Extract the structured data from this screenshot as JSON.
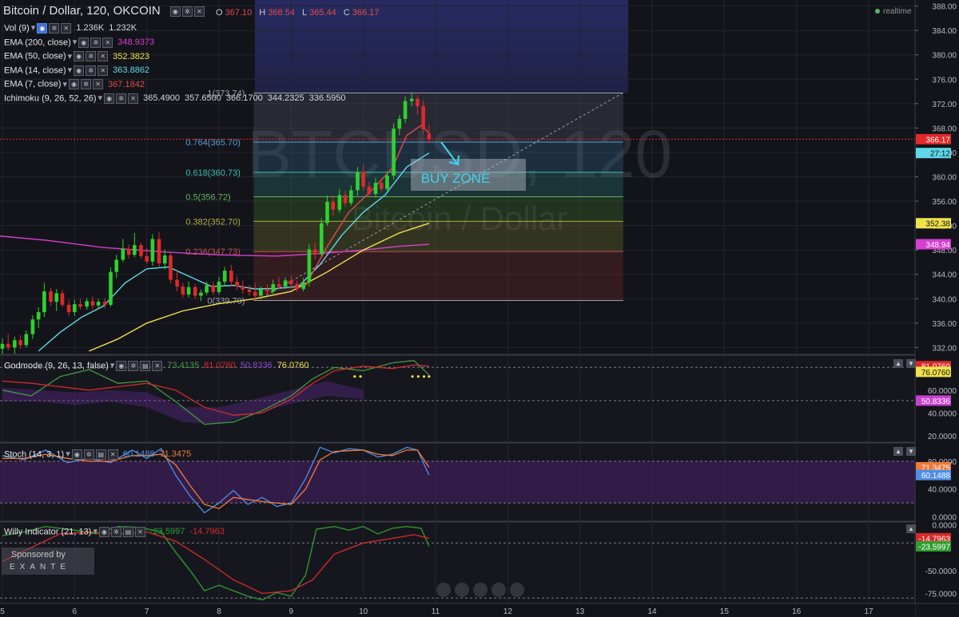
{
  "header": {
    "symbol": "Bitcoin / Dollar, 120, OKCOIN",
    "open_label": "O",
    "open": "367.10",
    "high_label": "H",
    "high": "368.54",
    "low_label": "L",
    "low": "365.44",
    "close_label": "C",
    "close": "366.17",
    "realtime": "realtime"
  },
  "legend": [
    {
      "name": "Vol (9)",
      "values": [
        "1.236K",
        "1.232K"
      ],
      "colors": [
        "#d5d7dd",
        "#d5d7dd"
      ]
    },
    {
      "name": "EMA (200, close)",
      "values": [
        "348.9373"
      ],
      "colors": [
        "#d63fd0"
      ]
    },
    {
      "name": "EMA (50, close)",
      "values": [
        "352.3823"
      ],
      "colors": [
        "#f0e24a"
      ]
    },
    {
      "name": "EMA (14, close)",
      "values": [
        "363.8862"
      ],
      "colors": [
        "#5fd8e8"
      ]
    },
    {
      "name": "EMA (7, close)",
      "values": [
        "367.1842"
      ],
      "colors": [
        "#e04a4a"
      ]
    },
    {
      "name": "Ichimoku (9, 26, 52, 26)",
      "values": [
        "365.4900",
        "357.6500",
        "366.1700",
        "344.2325",
        "336.5950"
      ],
      "colors": [
        "#d5d7dd",
        "#d5d7dd",
        "#d5d7dd",
        "#d5d7dd",
        "#d5d7dd"
      ]
    }
  ],
  "watermark": {
    "line1": "BTCUSD, 120",
    "line2": "Bitcoin / Dollar"
  },
  "annotation": {
    "buy_zone": "BUY ZONE"
  },
  "sponsor": {
    "line1": "Sponsored by",
    "line2": "EXANTE"
  },
  "colors": {
    "up": "#2fd22f",
    "down": "#e02929",
    "ema200": "#d63fd0",
    "ema50": "#f0e24a",
    "ema14": "#5fd8e8",
    "ema7": "#e04a4a",
    "godmode_green": "#3f9a3f",
    "godmode_red": "#d62a2a",
    "stoch_k": "#4f8fe6",
    "stoch_d": "#f07a3a",
    "willy_green": "#2f9e2f",
    "willy_red": "#d62a2a"
  },
  "chart_data": {
    "type": "candlestick",
    "symbol": "Bitcoin / Dollar",
    "interval": "120",
    "exchange": "OKCOIN",
    "x_ticks": [
      "5",
      "6",
      "7",
      "8",
      "9",
      "10",
      "11",
      "12",
      "13",
      "14",
      "15",
      "16",
      "17"
    ],
    "y_ticks": [
      332,
      336,
      340,
      344,
      348,
      352,
      356,
      360,
      364,
      368,
      372,
      376,
      380,
      384,
      388
    ],
    "y_tick_labels": [
      "332.00",
      "336.00",
      "340.00",
      "344.00",
      "348.00",
      "352.00",
      "356.00",
      "360.00",
      "364.00",
      "368.00",
      "372.00",
      "376.00",
      "380.00",
      "384.00",
      "388.00"
    ],
    "ylim": [
      331,
      389
    ],
    "xlim": [
      4.95,
      17.3
    ],
    "price_tags": [
      {
        "value": 366.17,
        "label": "366.17",
        "color": "#e02929"
      },
      {
        "value": 363.9,
        "label": "27:12",
        "color": "#5fd8e8"
      },
      {
        "value": 352.38,
        "label": "352.38",
        "color": "#f0e24a"
      },
      {
        "value": 348.94,
        "label": "348.94",
        "color": "#d63fd0"
      }
    ],
    "fibonacci": {
      "x_start": 8.48,
      "x_end": 13.6,
      "levels": [
        {
          "ratio_label": "1(373.74)",
          "price": 373.74,
          "color": "#9aa0aa"
        },
        {
          "ratio_label": "0.764(365.70)",
          "price": 365.7,
          "color": "#5f9bd0"
        },
        {
          "ratio_label": "0.618(360.73)",
          "price": 360.73,
          "color": "#3fbfb0"
        },
        {
          "ratio_label": "0.5(356.72)",
          "price": 356.72,
          "color": "#5fb55f"
        },
        {
          "ratio_label": "0.382(352.70)",
          "price": 352.7,
          "color": "#b0b040"
        },
        {
          "ratio_label": "0.236(347.73)",
          "price": 347.73,
          "color": "#c05050"
        },
        {
          "ratio_label": "0(339.70)",
          "price": 339.7,
          "color": "#9aa0aa"
        }
      ]
    },
    "candles": [
      {
        "t": 5.0,
        "o": 331.8,
        "h": 333.5,
        "l": 330.9,
        "c": 332.6
      },
      {
        "t": 5.08,
        "o": 332.6,
        "h": 334.2,
        "l": 331.5,
        "c": 332.0
      },
      {
        "t": 5.17,
        "o": 332.0,
        "h": 333.8,
        "l": 331.0,
        "c": 333.2
      },
      {
        "t": 5.25,
        "o": 333.2,
        "h": 334.0,
        "l": 331.8,
        "c": 332.4
      },
      {
        "t": 5.33,
        "o": 332.4,
        "h": 334.8,
        "l": 332.0,
        "c": 334.2
      },
      {
        "t": 5.42,
        "o": 334.2,
        "h": 337.3,
        "l": 333.4,
        "c": 336.6
      },
      {
        "t": 5.5,
        "o": 336.6,
        "h": 338.6,
        "l": 335.2,
        "c": 337.8
      },
      {
        "t": 5.58,
        "o": 337.8,
        "h": 342.6,
        "l": 337.0,
        "c": 341.2
      },
      {
        "t": 5.67,
        "o": 341.2,
        "h": 341.8,
        "l": 338.9,
        "c": 339.5
      },
      {
        "t": 5.75,
        "o": 339.5,
        "h": 341.6,
        "l": 338.0,
        "c": 340.9
      },
      {
        "t": 5.83,
        "o": 340.9,
        "h": 341.5,
        "l": 338.6,
        "c": 339.0
      },
      {
        "t": 5.92,
        "o": 339.0,
        "h": 339.8,
        "l": 337.2,
        "c": 337.8
      },
      {
        "t": 6.0,
        "o": 337.8,
        "h": 339.8,
        "l": 337.2,
        "c": 339.1
      },
      {
        "t": 6.08,
        "o": 339.1,
        "h": 340.0,
        "l": 338.2,
        "c": 338.7
      },
      {
        "t": 6.17,
        "o": 338.7,
        "h": 340.1,
        "l": 338.2,
        "c": 339.6
      },
      {
        "t": 6.25,
        "o": 339.6,
        "h": 340.4,
        "l": 338.3,
        "c": 338.9
      },
      {
        "t": 6.33,
        "o": 338.9,
        "h": 340.0,
        "l": 338.3,
        "c": 339.5
      },
      {
        "t": 6.42,
        "o": 339.5,
        "h": 340.1,
        "l": 338.4,
        "c": 339.0
      },
      {
        "t": 6.5,
        "o": 339.0,
        "h": 345.1,
        "l": 338.7,
        "c": 344.4
      },
      {
        "t": 6.58,
        "o": 344.4,
        "h": 347.2,
        "l": 343.4,
        "c": 346.4
      },
      {
        "t": 6.67,
        "o": 346.4,
        "h": 349.8,
        "l": 346.0,
        "c": 348.2
      },
      {
        "t": 6.75,
        "o": 348.2,
        "h": 348.9,
        "l": 346.6,
        "c": 347.2
      },
      {
        "t": 6.83,
        "o": 347.2,
        "h": 350.8,
        "l": 346.8,
        "c": 348.8
      },
      {
        "t": 6.92,
        "o": 348.8,
        "h": 349.2,
        "l": 346.6,
        "c": 347.0
      },
      {
        "t": 7.0,
        "o": 347.0,
        "h": 348.4,
        "l": 345.7,
        "c": 346.1
      },
      {
        "t": 7.08,
        "o": 346.1,
        "h": 350.6,
        "l": 345.4,
        "c": 349.8
      },
      {
        "t": 7.17,
        "o": 349.8,
        "h": 351.0,
        "l": 345.2,
        "c": 345.8
      },
      {
        "t": 7.25,
        "o": 345.8,
        "h": 348.1,
        "l": 344.8,
        "c": 347.1
      },
      {
        "t": 7.33,
        "o": 347.1,
        "h": 347.5,
        "l": 342.5,
        "c": 343.1
      },
      {
        "t": 7.42,
        "o": 343.1,
        "h": 344.6,
        "l": 341.2,
        "c": 342.0
      },
      {
        "t": 7.5,
        "o": 342.0,
        "h": 342.6,
        "l": 340.2,
        "c": 340.7
      },
      {
        "t": 7.58,
        "o": 340.7,
        "h": 342.8,
        "l": 340.2,
        "c": 341.9
      },
      {
        "t": 7.67,
        "o": 341.9,
        "h": 342.4,
        "l": 340.0,
        "c": 340.5
      },
      {
        "t": 7.75,
        "o": 340.5,
        "h": 341.5,
        "l": 339.6,
        "c": 341.0
      },
      {
        "t": 7.83,
        "o": 341.0,
        "h": 342.8,
        "l": 340.6,
        "c": 342.2
      },
      {
        "t": 7.92,
        "o": 342.2,
        "h": 342.8,
        "l": 340.6,
        "c": 341.1
      },
      {
        "t": 8.0,
        "o": 341.1,
        "h": 343.6,
        "l": 340.7,
        "c": 342.8
      },
      {
        "t": 8.08,
        "o": 342.8,
        "h": 345.2,
        "l": 342.1,
        "c": 344.6
      },
      {
        "t": 8.17,
        "o": 344.6,
        "h": 345.5,
        "l": 342.0,
        "c": 342.8
      },
      {
        "t": 8.25,
        "o": 342.8,
        "h": 343.6,
        "l": 341.4,
        "c": 342.0
      },
      {
        "t": 8.33,
        "o": 342.0,
        "h": 343.0,
        "l": 340.8,
        "c": 341.5
      },
      {
        "t": 8.42,
        "o": 341.5,
        "h": 342.3,
        "l": 340.5,
        "c": 341.1
      },
      {
        "t": 8.5,
        "o": 341.1,
        "h": 342.6,
        "l": 339.8,
        "c": 340.5
      },
      {
        "t": 8.58,
        "o": 340.5,
        "h": 342.0,
        "l": 339.9,
        "c": 341.6
      },
      {
        "t": 8.67,
        "o": 341.6,
        "h": 342.4,
        "l": 340.8,
        "c": 341.2
      },
      {
        "t": 8.75,
        "o": 341.2,
        "h": 343.1,
        "l": 340.8,
        "c": 342.4
      },
      {
        "t": 8.83,
        "o": 342.4,
        "h": 343.6,
        "l": 341.6,
        "c": 342.0
      },
      {
        "t": 8.92,
        "o": 342.0,
        "h": 343.5,
        "l": 341.6,
        "c": 343.0
      },
      {
        "t": 9.0,
        "o": 343.0,
        "h": 343.8,
        "l": 341.7,
        "c": 342.4
      },
      {
        "t": 9.08,
        "o": 342.4,
        "h": 342.9,
        "l": 341.2,
        "c": 341.6
      },
      {
        "t": 9.17,
        "o": 341.6,
        "h": 343.4,
        "l": 341.2,
        "c": 342.7
      },
      {
        "t": 9.25,
        "o": 342.7,
        "h": 348.9,
        "l": 342.0,
        "c": 348.1
      },
      {
        "t": 9.33,
        "o": 348.1,
        "h": 349.2,
        "l": 346.4,
        "c": 347.3
      },
      {
        "t": 9.42,
        "o": 347.3,
        "h": 353.2,
        "l": 347.0,
        "c": 352.4
      },
      {
        "t": 9.5,
        "o": 352.4,
        "h": 356.9,
        "l": 352.0,
        "c": 355.9
      },
      {
        "t": 9.58,
        "o": 355.9,
        "h": 357.0,
        "l": 353.6,
        "c": 354.6
      },
      {
        "t": 9.67,
        "o": 354.6,
        "h": 358.0,
        "l": 354.1,
        "c": 357.0
      },
      {
        "t": 9.75,
        "o": 357.0,
        "h": 357.8,
        "l": 355.0,
        "c": 355.7
      },
      {
        "t": 9.83,
        "o": 355.7,
        "h": 358.6,
        "l": 355.3,
        "c": 357.8
      },
      {
        "t": 9.92,
        "o": 357.8,
        "h": 361.6,
        "l": 356.9,
        "c": 360.8
      },
      {
        "t": 10.0,
        "o": 360.8,
        "h": 362.0,
        "l": 357.7,
        "c": 358.4
      },
      {
        "t": 10.08,
        "o": 358.4,
        "h": 359.2,
        "l": 356.6,
        "c": 357.2
      },
      {
        "t": 10.17,
        "o": 357.2,
        "h": 359.8,
        "l": 356.6,
        "c": 359.0
      },
      {
        "t": 10.25,
        "o": 359.0,
        "h": 359.8,
        "l": 357.6,
        "c": 358.0
      },
      {
        "t": 10.33,
        "o": 358.0,
        "h": 361.0,
        "l": 357.7,
        "c": 360.2
      },
      {
        "t": 10.42,
        "o": 360.2,
        "h": 368.8,
        "l": 359.6,
        "c": 367.9
      },
      {
        "t": 10.5,
        "o": 367.9,
        "h": 370.1,
        "l": 366.8,
        "c": 369.5
      },
      {
        "t": 10.58,
        "o": 369.5,
        "h": 373.2,
        "l": 368.8,
        "c": 372.4
      },
      {
        "t": 10.67,
        "o": 372.4,
        "h": 373.7,
        "l": 371.6,
        "c": 372.8
      },
      {
        "t": 10.75,
        "o": 372.8,
        "h": 373.4,
        "l": 370.2,
        "c": 371.6
      },
      {
        "t": 10.83,
        "o": 371.6,
        "h": 372.6,
        "l": 367.1,
        "c": 367.8
      },
      {
        "t": 10.91,
        "o": 367.1,
        "h": 368.54,
        "l": 365.44,
        "c": 366.17
      }
    ],
    "ema_lines": [
      {
        "name": "EMA (200, close)",
        "color": "#d63fd0",
        "points": [
          [
            4.95,
            350.3
          ],
          [
            5.6,
            349.6
          ],
          [
            6.4,
            348.4
          ],
          [
            7.2,
            347.7
          ],
          [
            8.0,
            347.2
          ],
          [
            8.8,
            347.0
          ],
          [
            9.4,
            347.4
          ],
          [
            10.0,
            348.0
          ],
          [
            10.5,
            348.6
          ],
          [
            10.91,
            348.94
          ]
        ]
      },
      {
        "name": "EMA (50, close)",
        "color": "#f0e24a",
        "points": [
          [
            6.2,
            331.4
          ],
          [
            6.6,
            333.4
          ],
          [
            7.0,
            336.0
          ],
          [
            7.5,
            338.0
          ],
          [
            8.0,
            339.2
          ],
          [
            8.5,
            340.0
          ],
          [
            9.0,
            341.2
          ],
          [
            9.5,
            344.4
          ],
          [
            10.0,
            348.0
          ],
          [
            10.5,
            350.8
          ],
          [
            10.91,
            352.38
          ]
        ]
      },
      {
        "name": "EMA (14, close)",
        "color": "#5fd8e8",
        "points": [
          [
            5.5,
            331.4
          ],
          [
            5.8,
            334.5
          ],
          [
            6.1,
            337.0
          ],
          [
            6.4,
            338.8
          ],
          [
            6.7,
            342.6
          ],
          [
            7.0,
            344.9
          ],
          [
            7.3,
            345.2
          ],
          [
            7.6,
            343.6
          ],
          [
            7.9,
            342.0
          ],
          [
            8.2,
            342.2
          ],
          [
            8.5,
            341.6
          ],
          [
            8.8,
            341.7
          ],
          [
            9.1,
            342.0
          ],
          [
            9.4,
            345.6
          ],
          [
            9.7,
            350.4
          ],
          [
            10.0,
            354.2
          ],
          [
            10.3,
            357.0
          ],
          [
            10.6,
            361.6
          ],
          [
            10.91,
            363.9
          ]
        ]
      },
      {
        "name": "EMA (7, close)",
        "color": "#e04a4a",
        "points": [
          [
            9.2,
            342.2
          ],
          [
            9.5,
            348.6
          ],
          [
            9.8,
            354.2
          ],
          [
            10.1,
            357.6
          ],
          [
            10.4,
            361.4
          ],
          [
            10.6,
            366.8
          ],
          [
            10.8,
            368.4
          ],
          [
            10.91,
            367.2
          ]
        ]
      }
    ],
    "trendline": {
      "points": [
        [
          8.6,
          340.2
        ],
        [
          13.6,
          373.8
        ]
      ]
    },
    "godmode": {
      "name": "Godmode (9, 26, 13, false)",
      "values": [
        "73.4135",
        "81.0760",
        "50.8336",
        "76.0760"
      ],
      "ylim": [
        15,
        90
      ],
      "ticks": [
        "20.0000",
        "40.0000",
        "60.0000"
      ],
      "tags": [
        {
          "value": 81.076,
          "label": "81.0760",
          "color": "#d62a2a"
        },
        {
          "value": 76.076,
          "label": "76.0760",
          "color": "#f0e24a"
        },
        {
          "value": 50.8336,
          "label": "50.8336",
          "color": "#c940d0"
        }
      ]
    },
    "stoch": {
      "name": "Stoch (14, 3, 1)",
      "values": [
        "60.1488",
        "71.3475"
      ],
      "ylim": [
        -5,
        105
      ],
      "ticks": [
        "0.0000",
        "40.0000",
        "80.0000"
      ],
      "tags": [
        {
          "value": 71.3475,
          "label": "71.3475",
          "color": "#f07a3a"
        },
        {
          "value": 60.1488,
          "label": "60.1488",
          "color": "#4f8fe6"
        }
      ]
    },
    "willy": {
      "name": "Willy Indicator (21, 13)",
      "values": [
        "-23.5997",
        "-14.7963"
      ],
      "ylim": [
        -85,
        2
      ],
      "ticks": [
        "0.0000",
        "-50.0000",
        "-75.0000"
      ],
      "tags": [
        {
          "value": -14.7963,
          "label": "-14.7963",
          "color": "#d62a2a"
        },
        {
          "value": -23.5997,
          "label": "-23.5997",
          "color": "#2f9e2f"
        }
      ]
    }
  }
}
